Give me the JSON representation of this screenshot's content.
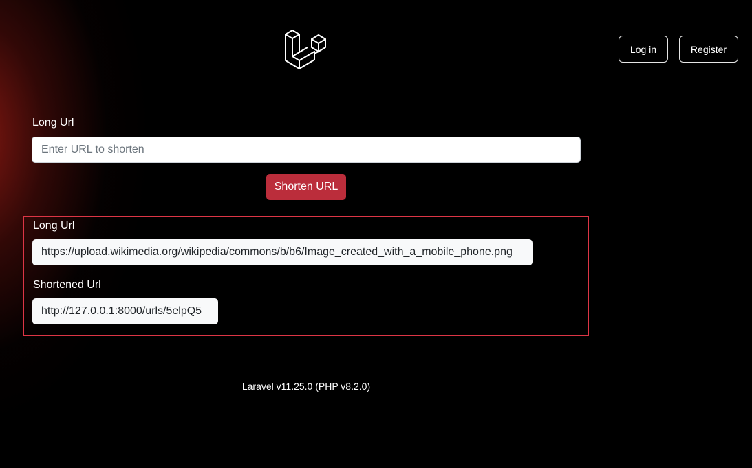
{
  "header": {
    "logo_icon": "laravel-logo-icon",
    "login_label": "Log in",
    "register_label": "Register"
  },
  "form": {
    "long_url_label": "Long Url",
    "input_placeholder": "Enter URL to shorten",
    "input_value": "",
    "submit_label": "Shorten URL"
  },
  "result": {
    "long_url_label": "Long Url",
    "long_url_value": "https://upload.wikimedia.org/wikipedia/commons/b/b6/Image_created_with_a_mobile_phone.png",
    "short_url_label": "Shortened Url",
    "short_url_value": "http://127.0.0.1:8000/urls/5elpQ5"
  },
  "footer": {
    "version": "Laravel v11.25.0 (PHP v8.2.0)"
  },
  "colors": {
    "background": "#000000",
    "accent_glow": "#8c1912",
    "button_danger": "#bb2d3b",
    "result_border": "#dc3545"
  }
}
